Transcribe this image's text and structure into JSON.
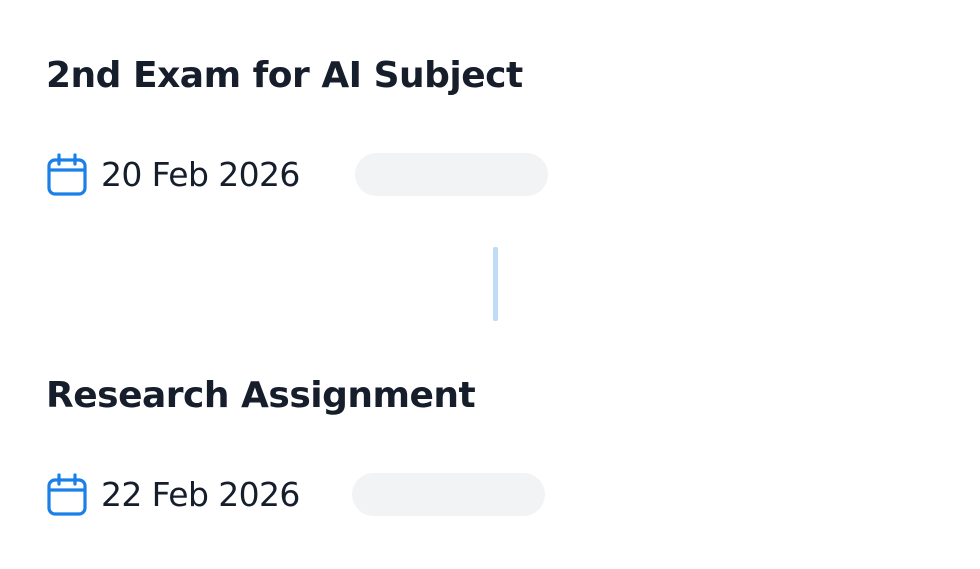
{
  "timeline": {
    "items": [
      {
        "title": "2nd Exam for AI Subject",
        "date": "20 Feb 2026",
        "icon": "calendar-icon"
      },
      {
        "title": "Research Assignment",
        "date": "22 Feb 2026",
        "icon": "calendar-icon"
      }
    ],
    "colors": {
      "icon": "#1a7fe8",
      "connector": "#bedbf8",
      "pill": "#f2f3f5",
      "text": "#161e2c"
    }
  }
}
